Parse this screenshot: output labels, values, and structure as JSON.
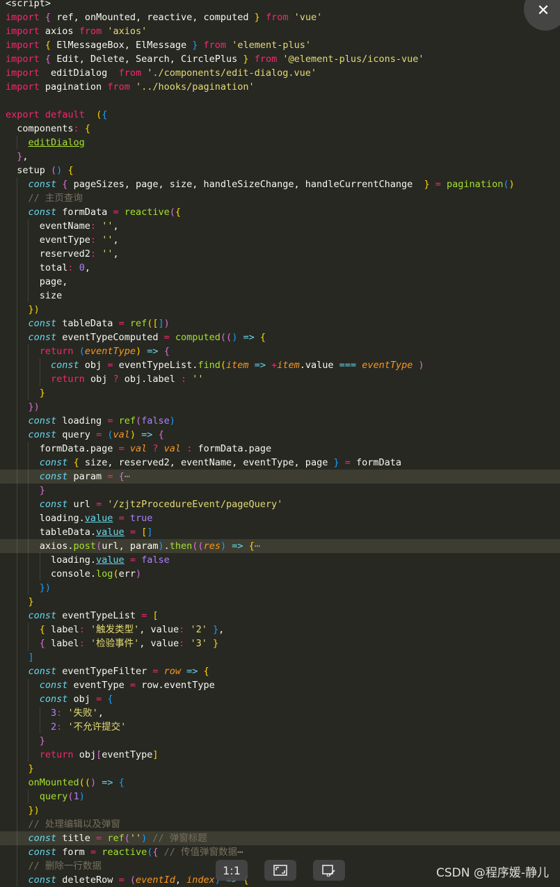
{
  "colors": {
    "background": "#272822",
    "keyword": "#F92672",
    "string": "#E6DB74",
    "function": "#A6E22E",
    "declaration": "#66D9EF",
    "parameter": "#FD971F",
    "comment": "#75715E",
    "number": "#AE81FF"
  },
  "code": {
    "lines": [
      "<script>",
      "import { ref, onMounted, reactive, computed } from 'vue'",
      "import axios from 'axios'",
      "import { ElMessageBox, ElMessage } from 'element-plus'",
      "import { Edit, Delete, Search, CirclePlus } from '@element-plus/icons-vue'",
      "import  editDialog  from './components/edit-dialog.vue'",
      "import pagination from '../hooks/pagination'",
      "",
      "export default  ({",
      "  components: {",
      "    editDialog",
      "  },",
      "  setup () {",
      "    const { pageSizes, page, size, handleSizeChange, handleCurrentChange  } = pagination()",
      "    // 主页查询",
      "    const formData = reactive({",
      "      eventName: '',",
      "      eventType: '',",
      "      reserved2: '',",
      "      total: 0,",
      "      page,",
      "      size",
      "    })",
      "    const tableData = ref([])",
      "    const eventTypeComputed = computed(() => {",
      "      return (eventType) => {",
      "        const obj = eventTypeList.find(item => +item.value === eventType )",
      "        return obj ? obj.label : ''",
      "      }",
      "    })",
      "    const loading = ref(false)",
      "    const query = (val) => {",
      "      formData.page = val ? val : formData.page",
      "      const { size, reserved2, eventName, eventType, page } = formData",
      "      const param = {⋯",
      "      }",
      "      const url = '/zjtzProcedureEvent/pageQuery'",
      "      loading.value = true",
      "      tableData.value = []",
      "      axios.post(url, param).then((res) => {⋯",
      "        loading.value = false",
      "        console.log(err)",
      "      })",
      "    }",
      "    const eventTypeList = [",
      "      { label: '触发类型', value: '2' },",
      "      { label: '检验事件', value: '3' }",
      "    ]",
      "    const eventTypeFilter = row => {",
      "      const eventType = row.eventType",
      "      const obj = {",
      "        3: '失败',",
      "        2: '不允许提交'",
      "      }",
      "      return obj[eventType]",
      "    }",
      "    onMounted(() => {",
      "      query(1)",
      "    })",
      "    // 处理编辑以及弹窗",
      "    const title = ref('') // 弹窗标题",
      "    const form = reactive({ // 传值弹窗数据⋯",
      "    // 删除一行数据",
      "    const deleteRow = (eventId, index) => {"
    ]
  },
  "viewer": {
    "close_icon": "close-icon",
    "zoom_label": "1:1",
    "fit_icon": "fit-screen-icon",
    "edit_icon": "edit-image-icon",
    "watermark": "CSDN @程序媛-静儿"
  }
}
